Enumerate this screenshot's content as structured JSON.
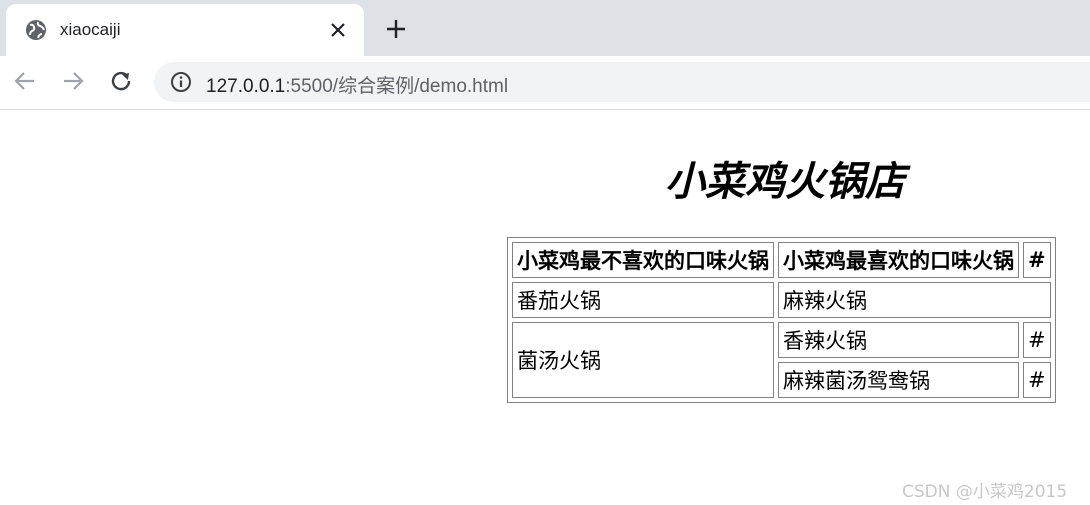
{
  "browser": {
    "tab": {
      "title": "xiaocaiji"
    },
    "address_bar": {
      "host": "127.0.0.1",
      "path": ":5500/综合案例/demo.html"
    }
  },
  "page": {
    "title": "小菜鸡火锅店",
    "table": {
      "headers": [
        "小菜鸡最不喜欢的口味火锅",
        "小菜鸡最喜欢的口味火锅",
        "#"
      ],
      "rows": [
        [
          "番茄火锅",
          "麻辣火锅"
        ],
        [
          "菌汤火锅",
          "香辣火锅",
          "#"
        ],
        [
          "麻辣菌汤鸳鸯锅",
          "#"
        ]
      ]
    }
  },
  "watermark": "CSDN @小菜鸡2015"
}
